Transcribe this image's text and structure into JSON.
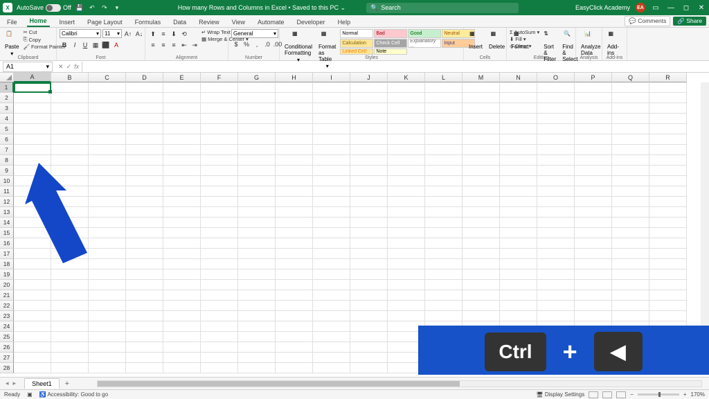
{
  "titlebar": {
    "autosave_label": "AutoSave",
    "autosave_state": "Off",
    "doc_title": "How many Rows and Columns in Excel",
    "save_status": "Saved to this PC",
    "search_placeholder": "Search",
    "account_name": "EasyClick Academy",
    "account_initials": "EA"
  },
  "tabs": [
    "File",
    "Home",
    "Insert",
    "Page Layout",
    "Formulas",
    "Data",
    "Review",
    "View",
    "Automate",
    "Developer",
    "Help"
  ],
  "active_tab": "Home",
  "comments_btn": "Comments",
  "share_btn": "Share",
  "ribbon": {
    "clipboard": {
      "label": "Clipboard",
      "paste": "Paste",
      "cut": "Cut",
      "copy": "Copy",
      "fp": "Format Painter"
    },
    "font": {
      "label": "Font",
      "name": "Calibri",
      "size": "11"
    },
    "alignment": {
      "label": "Alignment",
      "wrap": "Wrap Text",
      "merge": "Merge & Center"
    },
    "number": {
      "label": "Number",
      "format": "General"
    },
    "styles": {
      "label": "Styles",
      "cf": "Conditional Formatting",
      "fat": "Format as Table",
      "cells": [
        "Normal",
        "Bad",
        "Good",
        "Neutral",
        "Calculation",
        "Check Cell",
        "Explanatory ...",
        "Input",
        "Linked Cell",
        "Note"
      ]
    },
    "cells": {
      "label": "Cells",
      "insert": "Insert",
      "delete": "Delete",
      "format": "Format"
    },
    "editing": {
      "label": "Editing",
      "autosum": "AutoSum",
      "fill": "Fill",
      "clear": "Clear",
      "sort": "Sort & Filter",
      "find": "Find & Select"
    },
    "analysis": {
      "label": "Analysis",
      "analyze": "Analyze Data"
    },
    "addins": {
      "label": "Add-ins",
      "addins": "Add-ins"
    }
  },
  "namebox": "A1",
  "columns": [
    "A",
    "B",
    "C",
    "D",
    "E",
    "F",
    "G",
    "H",
    "I",
    "J",
    "K",
    "L",
    "M",
    "N",
    "O",
    "P",
    "Q",
    "R"
  ],
  "rows": [
    1,
    2,
    3,
    4,
    5,
    6,
    7,
    8,
    9,
    10,
    11,
    12,
    13,
    14,
    15,
    16,
    17,
    18,
    19,
    20,
    21,
    22,
    23,
    24,
    25,
    26,
    27,
    28
  ],
  "active_cell": {
    "col": "A",
    "row": 1
  },
  "key_overlay": {
    "key1": "Ctrl",
    "op": "+",
    "key2": "◀"
  },
  "sheet": {
    "name": "Sheet1"
  },
  "statusbar": {
    "ready": "Ready",
    "access": "Accessibility: Good to go",
    "display": "Display Settings",
    "zoom": "170%"
  }
}
